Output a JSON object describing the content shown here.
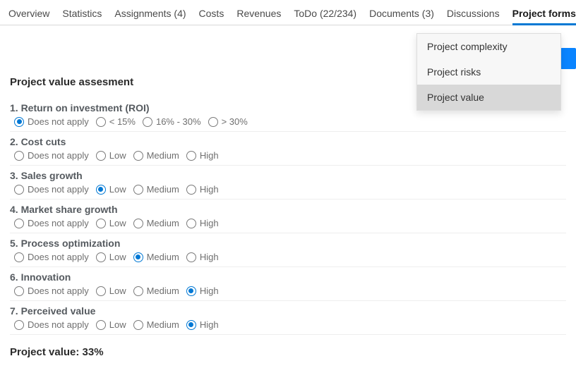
{
  "tabs": [
    {
      "label": "Overview",
      "active": false
    },
    {
      "label": "Statistics",
      "active": false
    },
    {
      "label": "Assignments (4)",
      "active": false
    },
    {
      "label": "Costs",
      "active": false
    },
    {
      "label": "Revenues",
      "active": false
    },
    {
      "label": "ToDo (22/234)",
      "active": false
    },
    {
      "label": "Documents (3)",
      "active": false
    },
    {
      "label": "Discussions",
      "active": false
    },
    {
      "label": "Project forms",
      "active": true
    }
  ],
  "dropdown": {
    "items": [
      {
        "label": "Project complexity",
        "selected": false
      },
      {
        "label": "Project risks",
        "selected": false
      },
      {
        "label": "Project value",
        "selected": true
      }
    ]
  },
  "section_title": "Project value assesment",
  "questions": [
    {
      "title": "1. Return on investment (ROI)",
      "options": [
        "Does not apply",
        "< 15%",
        "16% - 30%",
        "> 30%"
      ],
      "selected": 0
    },
    {
      "title": "2. Cost cuts",
      "options": [
        "Does not apply",
        "Low",
        "Medium",
        "High"
      ],
      "selected": -1
    },
    {
      "title": "3. Sales growth",
      "options": [
        "Does not apply",
        "Low",
        "Medium",
        "High"
      ],
      "selected": 1
    },
    {
      "title": "4. Market share growth",
      "options": [
        "Does not apply",
        "Low",
        "Medium",
        "High"
      ],
      "selected": -1
    },
    {
      "title": "5. Process optimization",
      "options": [
        "Does not apply",
        "Low",
        "Medium",
        "High"
      ],
      "selected": 2
    },
    {
      "title": "6. Innovation",
      "options": [
        "Does not apply",
        "Low",
        "Medium",
        "High"
      ],
      "selected": 3
    },
    {
      "title": "7. Perceived value",
      "options": [
        "Does not apply",
        "Low",
        "Medium",
        "High"
      ],
      "selected": 3
    }
  ],
  "result_label": "Project value: 33%"
}
